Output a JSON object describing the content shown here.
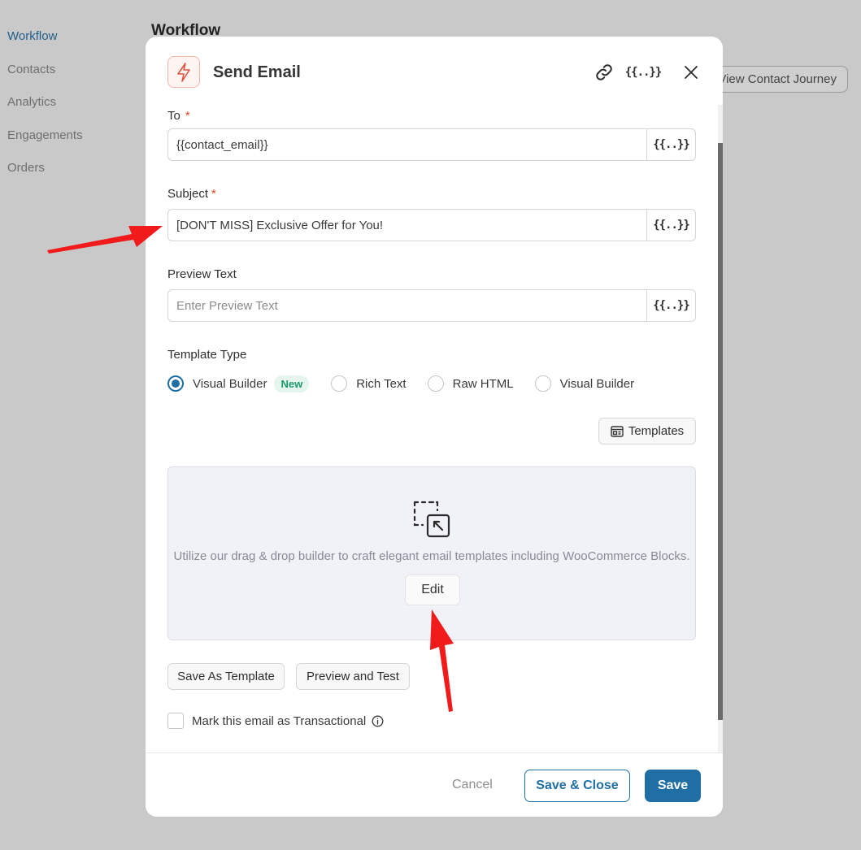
{
  "background": {
    "nav_items": [
      {
        "label": "Workflow",
        "active": true
      },
      {
        "label": "Contacts",
        "active": false
      },
      {
        "label": "Analytics",
        "active": false
      },
      {
        "label": "Engagements",
        "active": false
      },
      {
        "label": "Orders",
        "active": false
      }
    ],
    "page_title": "Workflow",
    "journey_button": "View Contact Journey"
  },
  "modal": {
    "title": "Send Email",
    "header_icons": [
      "link-icon",
      "merge-tags-icon",
      "close-icon"
    ],
    "to": {
      "label": "To",
      "value": "{{contact_email}}",
      "required_mark": "*"
    },
    "subject": {
      "label": "Subject",
      "value": "[DON'T MISS] Exclusive Offer for You!",
      "required_mark": "*"
    },
    "preview_text": {
      "label": "Preview Text",
      "value": "",
      "placeholder": "Enter Preview Text"
    },
    "merge_tag_glyph": "{{..}}",
    "template_type": {
      "label": "Template Type",
      "options": [
        {
          "label": "Visual Builder",
          "selected": true,
          "badge": "New"
        },
        {
          "label": "Rich Text",
          "selected": false
        },
        {
          "label": "Raw HTML",
          "selected": false
        },
        {
          "label": "Visual Builder",
          "selected": false
        }
      ]
    },
    "templates_button": "Templates",
    "builder": {
      "description": "Utilize our drag & drop builder to craft elegant email templates including WooCommerce Blocks.",
      "edit_button": "Edit"
    },
    "save_as_template_button": "Save As Template",
    "preview_test_button": "Preview and Test",
    "transactional_label": "Mark this email as Transactional",
    "transactional_checked": false,
    "footer": {
      "cancel": "Cancel",
      "save_close": "Save & Close",
      "save": "Save"
    }
  },
  "colors": {
    "accent": "#1f6fa5",
    "annotation_arrow": "#f11b1b",
    "badge_green": "#1d9a6c"
  }
}
